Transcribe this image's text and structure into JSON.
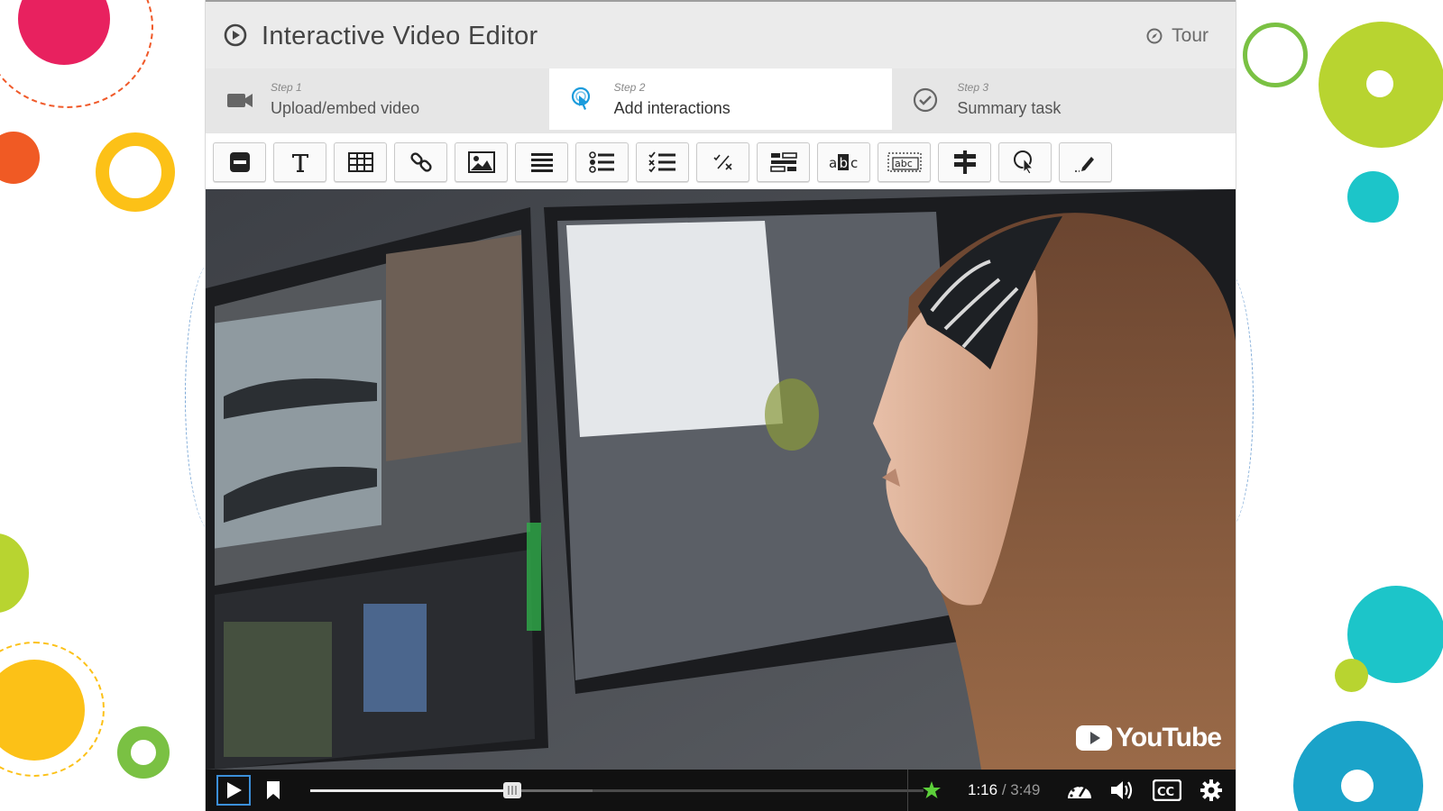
{
  "header": {
    "title": "Interactive Video Editor",
    "tour_label": "Tour"
  },
  "steps": [
    {
      "step": "Step 1",
      "label": "Upload/embed video",
      "icon": "video-camera-icon",
      "active": false
    },
    {
      "step": "Step 2",
      "label": "Add interactions",
      "icon": "touch-pointer-icon",
      "active": true
    },
    {
      "step": "Step 3",
      "label": "Summary task",
      "icon": "check-circle-icon",
      "active": false
    }
  ],
  "toolbar": {
    "tools": [
      "label-icon",
      "text-icon",
      "table-icon",
      "link-icon",
      "image-icon",
      "statements-icon",
      "single-choice-icon",
      "multiple-choice-icon",
      "true-false-icon",
      "drag-and-drop-icon",
      "mark-the-words-icon",
      "fill-in-blanks-icon",
      "crossroads-icon",
      "navigation-hotspot-icon",
      "free-text-question-icon"
    ]
  },
  "player": {
    "current_time": "1:16",
    "separator": " / ",
    "duration": "3:49",
    "progress": 0.33,
    "watermark": "YouTube"
  },
  "colors": {
    "accent": "#1a9bdc",
    "header_bg": "#ebebeb",
    "tab_bg": "#e6e6e6",
    "control_bar": "#111111"
  }
}
